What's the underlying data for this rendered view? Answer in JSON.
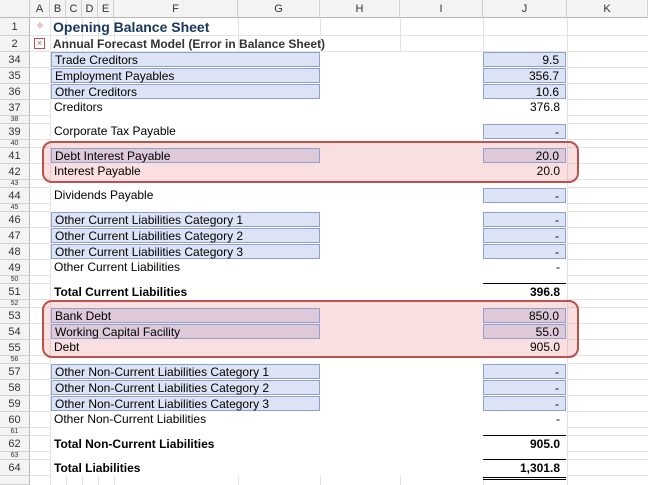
{
  "columns": [
    "A",
    "B",
    "C",
    "D",
    "E",
    "F",
    "G",
    "H",
    "I",
    "J",
    "K"
  ],
  "header": {
    "title": "Opening Balance Sheet",
    "subtitle": "Annual Forecast Model (Error in Balance Sheet)"
  },
  "rows": {
    "r1": "1",
    "r2": "2",
    "r34": "34",
    "r35": "35",
    "r36": "36",
    "r37": "37",
    "r38": "38",
    "r39": "39",
    "r40": "40",
    "r41": "41",
    "r42": "42",
    "r43": "43",
    "r44": "44",
    "r45": "45",
    "r46": "46",
    "r47": "47",
    "r48": "48",
    "r49": "49",
    "r50": "50",
    "r51": "51",
    "r52": "52",
    "r53": "53",
    "r54": "54",
    "r55": "55",
    "r56": "56",
    "r57": "57",
    "r58": "58",
    "r59": "59",
    "r60": "60",
    "r61": "61",
    "r62": "62",
    "r63": "63",
    "r64": "64"
  },
  "lines": {
    "trade_creditors": {
      "label": "Trade Creditors",
      "value": "9.5"
    },
    "employment_payables": {
      "label": "Employment Payables",
      "value": "356.7"
    },
    "other_creditors": {
      "label": "Other Creditors",
      "value": "10.6"
    },
    "creditors": {
      "label": "Creditors",
      "value": "376.8"
    },
    "corporate_tax": {
      "label": "Corporate Tax Payable",
      "value": "-"
    },
    "debt_interest": {
      "label": "Debt Interest Payable",
      "value": "20.0"
    },
    "interest_payable": {
      "label": "Interest Payable",
      "value": "20.0"
    },
    "dividends": {
      "label": "Dividends Payable",
      "value": "-"
    },
    "ocl1": {
      "label": "Other Current Liabilities Category 1",
      "value": "-"
    },
    "ocl2": {
      "label": "Other Current Liabilities Category 2",
      "value": "-"
    },
    "ocl3": {
      "label": "Other Current Liabilities Category 3",
      "value": "-"
    },
    "ocl": {
      "label": "Other Current Liabilities",
      "value": "-"
    },
    "tcl": {
      "label": "Total Current Liabilities",
      "value": "396.8"
    },
    "bank_debt": {
      "label": "Bank Debt",
      "value": "850.0"
    },
    "wcf": {
      "label": "Working Capital Facility",
      "value": "55.0"
    },
    "debt": {
      "label": "Debt",
      "value": "905.0"
    },
    "oncl1": {
      "label": "Other Non-Current Liabilities Category 1",
      "value": "-"
    },
    "oncl2": {
      "label": "Other Non-Current Liabilities Category 2",
      "value": "-"
    },
    "oncl3": {
      "label": "Other Non-Current Liabilities Category 3",
      "value": "-"
    },
    "oncl": {
      "label": "Other Non-Current Liabilities",
      "value": "-"
    },
    "tncl": {
      "label": "Total Non-Current Liabilities",
      "value": "905.0"
    },
    "tl": {
      "label": "Total Liabilities",
      "value": "1,301.8"
    }
  },
  "icons": {
    "row1": "expand-group-icon",
    "row2": "collapse-group-icon"
  },
  "colors": {
    "input_fill": "#dce3f5",
    "highlight_border": "#c0504d",
    "title": "#17375e"
  }
}
